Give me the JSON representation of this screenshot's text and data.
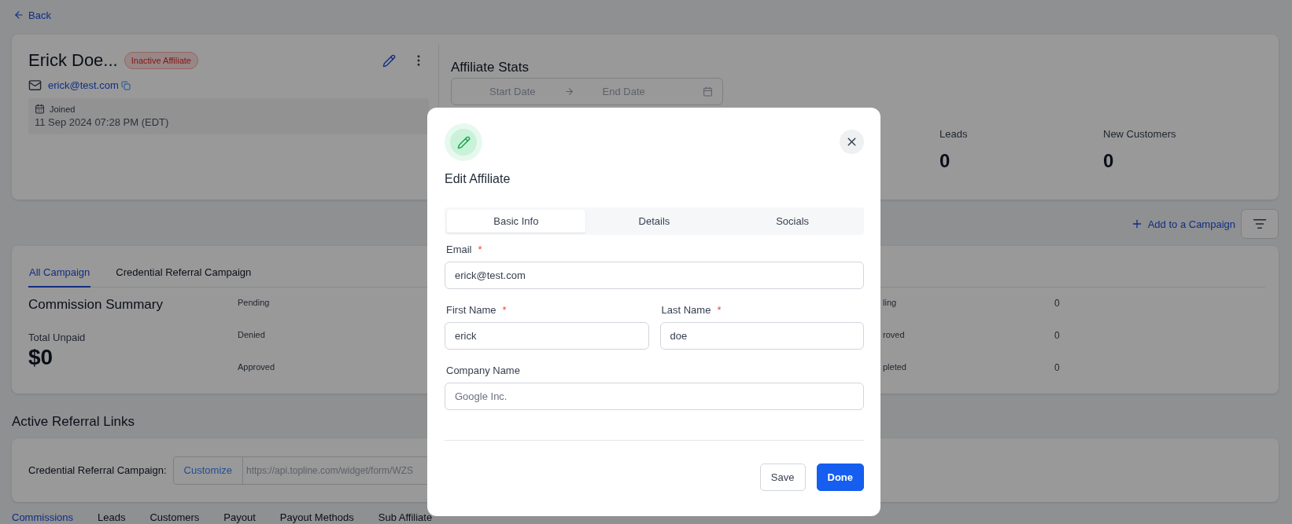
{
  "back_link": "Back",
  "affiliate": {
    "name": "Erick Doe...",
    "status_badge": "Inactive Affiliate",
    "email": "erick@test.com",
    "joined_label": "Joined",
    "joined_date": "11 Sep 2024 07:28 PM (EDT)"
  },
  "affiliate_stats": {
    "title": "Affiliate Stats",
    "start_placeholder": "Start Date",
    "end_placeholder": "End Date",
    "stats": [
      {
        "label": "Leads",
        "value": "0"
      },
      {
        "label": "New Customers",
        "value": "0"
      }
    ]
  },
  "add_to_campaign": "Add to a Campaign",
  "campaign_tabs": [
    {
      "label": "All Campaign",
      "selected": true
    },
    {
      "label": "Credential Referral Campaign",
      "selected": false
    }
  ],
  "commission_summary": {
    "title": "Commission Summary",
    "total_label": "Total Unpaid",
    "total_value": "$0",
    "statuses": [
      "Pending",
      "Denied",
      "Approved"
    ],
    "right_rows": [
      {
        "label": "ling",
        "value": "0"
      },
      {
        "label": "roved",
        "value": "0"
      },
      {
        "label": "pleted",
        "value": "0"
      }
    ]
  },
  "referral_links": {
    "title": "Active Referral Links",
    "links": [
      {
        "label": "Credential Referral Campaign:",
        "button": "Customize",
        "url": "https://api.topline.com/widget/form/WZS"
      }
    ]
  },
  "bottom_tabs": [
    {
      "label": "Commissions",
      "selected": true
    },
    {
      "label": "Leads",
      "selected": false
    },
    {
      "label": "Customers",
      "selected": false
    },
    {
      "label": "Payout",
      "selected": false
    },
    {
      "label": "Payout Methods",
      "selected": false
    },
    {
      "label": "Sub Affiliate",
      "selected": false
    }
  ],
  "modal": {
    "title": "Edit Affiliate",
    "tabs": [
      {
        "label": "Basic Info",
        "selected": true
      },
      {
        "label": "Details",
        "selected": false
      },
      {
        "label": "Socials",
        "selected": false
      }
    ],
    "fields": [
      {
        "label": "Email",
        "required_mark": "*",
        "value": "erick@test.com"
      },
      {
        "label": "First Name",
        "required_mark": "*",
        "value": "erick"
      },
      {
        "label": "Last Name",
        "required_mark": "*",
        "value": "doe"
      },
      {
        "label": "Company Name",
        "placeholder": "Google Inc."
      }
    ],
    "buttons": [
      {
        "label": "Save",
        "kind": "secondary"
      },
      {
        "label": "Done",
        "kind": "primary"
      }
    ]
  }
}
